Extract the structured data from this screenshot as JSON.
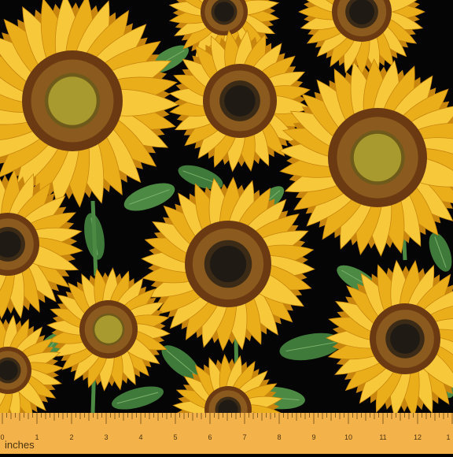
{
  "image": {
    "subject": "sunflowers",
    "colors": {
      "background": "#050505",
      "petal_light": "#F7C93A",
      "petal_mid": "#E9AE1A",
      "petal_dark": "#C8860E",
      "disk_outer": "#6B3A12",
      "disk_ring": "#8A5A1E",
      "disk_center_dark": "#1f1a14",
      "disk_center_green": "#A89A2E",
      "leaf": "#3F7A3A",
      "leaf_light": "#7FB26A",
      "ruler": "#F4B24A"
    }
  },
  "ruler": {
    "unit_label": "inches",
    "numbers": [
      "0",
      "1",
      "2",
      "3",
      "4",
      "5",
      "6",
      "7",
      "8",
      "9",
      "10",
      "11",
      "12",
      "1"
    ]
  }
}
